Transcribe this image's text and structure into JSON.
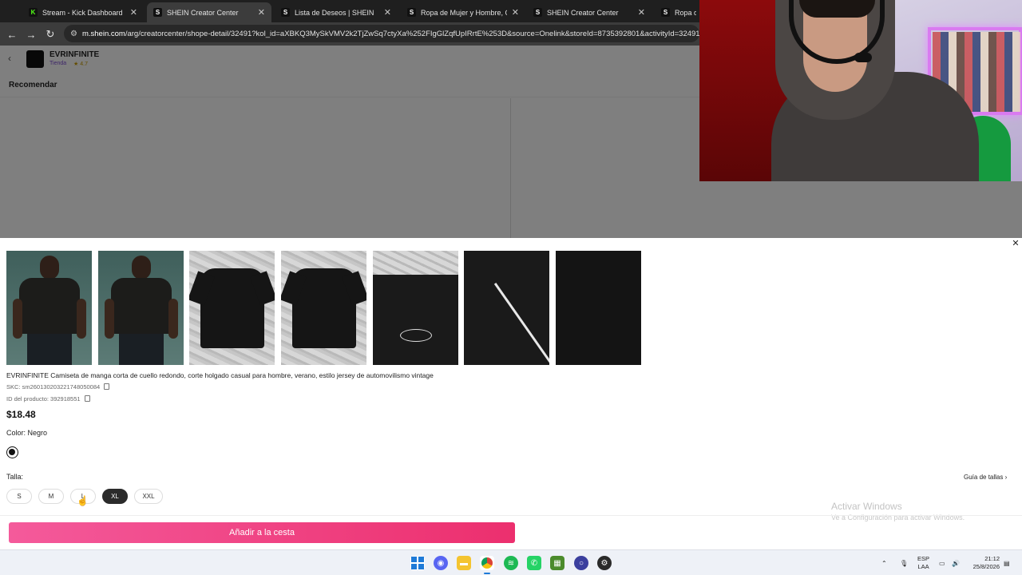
{
  "browser": {
    "tabs": [
      {
        "title": "Stream - Kick Dashboard",
        "favicon": "K",
        "active": false
      },
      {
        "title": "SHEIN Creator Center",
        "favicon": "S",
        "active": true
      },
      {
        "title": "Lista de Deseos | SHEIN",
        "favicon": "S",
        "active": false
      },
      {
        "title": "Ropa de Mujer y Hombre, Com",
        "favicon": "S",
        "active": false
      },
      {
        "title": "SHEIN Creator Center",
        "favicon": "S",
        "active": false
      },
      {
        "title": "Ropa de M",
        "favicon": "S",
        "active": false
      }
    ],
    "url_host": "m.shein.com",
    "url_rest": "/arg/creatorcenter/shope-detail/32491?kol_id=aXBKQ3MySkVMV2k2TjZwSq7ctyXa%252FIgGlZqfUpIRrtE%253D&source=Onelink&storeId=8735392801&activityId=32491"
  },
  "store": {
    "name": "EVRINFINITE",
    "sub": "Tienda",
    "rating": "4.7"
  },
  "page": {
    "recommend_label": "Recomendar"
  },
  "product": {
    "title": "EVRINFINITE Camiseta de manga corta de cuello redondo, corte holgado casual para hombre, verano, estilo jersey de automovilismo vintage",
    "sku_label": "SKC: sm2601302032217480500​84",
    "sku": "SKC: sm260130203221748050084",
    "product_id": "ID del producto: 392918551",
    "price": "$18.48",
    "color_label": "Color:",
    "color_value": "Negro",
    "size_label": "Talla:",
    "size_guide": "Guía de tallas",
    "sizes": [
      "S",
      "M",
      "L",
      "XL",
      "XXL"
    ],
    "selected_size": "XL",
    "add_to_cart": "Añadir a la cesta"
  },
  "watermark": {
    "title": "Activar Windows",
    "subtitle": "Ve a Configuración para activar Windows."
  },
  "taskbar": {
    "lang_line1": "ESP",
    "lang_line2": "LAA",
    "time": "21:12",
    "date": "25/8/2026"
  },
  "colors": {
    "accent_pink": "#ec2f6e",
    "selected_size_bg": "#2b2b2b",
    "browser_dark": "#1f1f1f"
  }
}
